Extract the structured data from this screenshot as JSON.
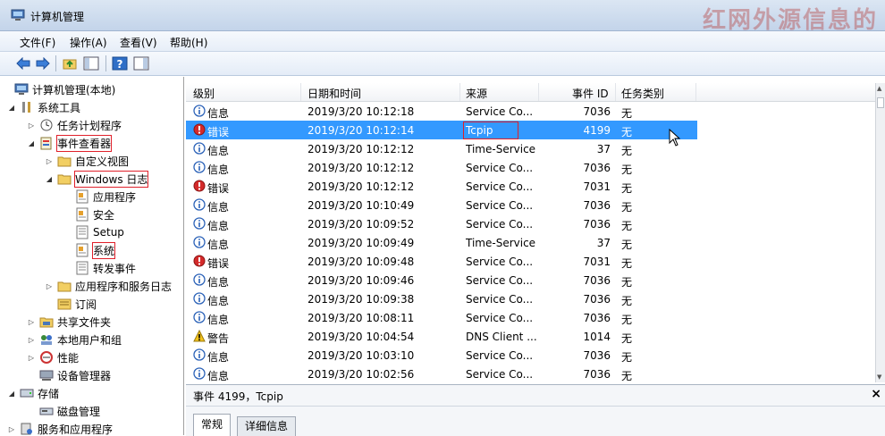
{
  "window": {
    "title": "计算机管理",
    "watermark": "红网外源信息的"
  },
  "menu": [
    "文件(F)",
    "操作(A)",
    "查看(V)",
    "帮助(H)"
  ],
  "toolbar": [
    "back-icon",
    "forward-icon",
    "folder-up-icon",
    "show-tree-icon",
    "help-icon",
    "show-pane-icon"
  ],
  "tree": [
    {
      "label": "计算机管理(本地)",
      "icon": "computer-icon",
      "arrow": "",
      "highlight": false
    },
    {
      "label": "系统工具",
      "icon": "tools-icon",
      "arrow": "◢",
      "highlight": false
    },
    {
      "label": "任务计划程序",
      "icon": "clock-icon",
      "arrow": "▷",
      "highlight": false
    },
    {
      "label": "事件查看器",
      "icon": "event-viewer-icon",
      "arrow": "◢",
      "highlight": true
    },
    {
      "label": "自定义视图",
      "icon": "folder-icon",
      "arrow": "▷",
      "highlight": false
    },
    {
      "label": "Windows 日志",
      "icon": "folder-icon",
      "arrow": "◢",
      "highlight": true
    },
    {
      "label": "应用程序",
      "icon": "log-icon",
      "arrow": "",
      "highlight": false
    },
    {
      "label": "安全",
      "icon": "log-icon",
      "arrow": "",
      "highlight": false
    },
    {
      "label": "Setup",
      "icon": "log-plain-icon",
      "arrow": "",
      "highlight": false
    },
    {
      "label": "系统",
      "icon": "log-icon",
      "arrow": "",
      "highlight": true
    },
    {
      "label": "转发事件",
      "icon": "log-plain-icon",
      "arrow": "",
      "highlight": false
    },
    {
      "label": "应用程序和服务日志",
      "icon": "folder-icon",
      "arrow": "▷",
      "highlight": false
    },
    {
      "label": "订阅",
      "icon": "subscription-icon",
      "arrow": "",
      "highlight": false
    },
    {
      "label": "共享文件夹",
      "icon": "shared-folder-icon",
      "arrow": "▷",
      "highlight": false
    },
    {
      "label": "本地用户和组",
      "icon": "users-icon",
      "arrow": "▷",
      "highlight": false
    },
    {
      "label": "性能",
      "icon": "performance-icon",
      "arrow": "▷",
      "highlight": false
    },
    {
      "label": "设备管理器",
      "icon": "device-manager-icon",
      "arrow": "",
      "highlight": false
    },
    {
      "label": "存储",
      "icon": "storage-icon",
      "arrow": "◢",
      "highlight": false
    },
    {
      "label": "磁盘管理",
      "icon": "disk-icon",
      "arrow": "",
      "highlight": false
    },
    {
      "label": "服务和应用程序",
      "icon": "services-icon",
      "arrow": "▷",
      "highlight": false
    }
  ],
  "columns": {
    "level": "级别",
    "datetime": "日期和时间",
    "source": "来源",
    "event_id": "事件 ID",
    "task": "任务类别"
  },
  "events": [
    {
      "type": "info",
      "level": "信息",
      "datetime": "2019/3/20 10:12:18",
      "source": "Service Co...",
      "event_id": "7036",
      "task": "无"
    },
    {
      "type": "error",
      "level": "错误",
      "datetime": "2019/3/20 10:12:14",
      "source": "Tcpip",
      "event_id": "4199",
      "task": "无",
      "selected": true
    },
    {
      "type": "info",
      "level": "信息",
      "datetime": "2019/3/20 10:12:12",
      "source": "Time-Service",
      "event_id": "37",
      "task": "无"
    },
    {
      "type": "info",
      "level": "信息",
      "datetime": "2019/3/20 10:12:12",
      "source": "Service Co...",
      "event_id": "7036",
      "task": "无"
    },
    {
      "type": "error",
      "level": "错误",
      "datetime": "2019/3/20 10:12:12",
      "source": "Service Co...",
      "event_id": "7031",
      "task": "无"
    },
    {
      "type": "info",
      "level": "信息",
      "datetime": "2019/3/20 10:10:49",
      "source": "Service Co...",
      "event_id": "7036",
      "task": "无"
    },
    {
      "type": "info",
      "level": "信息",
      "datetime": "2019/3/20 10:09:52",
      "source": "Service Co...",
      "event_id": "7036",
      "task": "无"
    },
    {
      "type": "info",
      "level": "信息",
      "datetime": "2019/3/20 10:09:49",
      "source": "Time-Service",
      "event_id": "37",
      "task": "无"
    },
    {
      "type": "error",
      "level": "错误",
      "datetime": "2019/3/20 10:09:48",
      "source": "Service Co...",
      "event_id": "7031",
      "task": "无"
    },
    {
      "type": "info",
      "level": "信息",
      "datetime": "2019/3/20 10:09:46",
      "source": "Service Co...",
      "event_id": "7036",
      "task": "无"
    },
    {
      "type": "info",
      "level": "信息",
      "datetime": "2019/3/20 10:09:38",
      "source": "Service Co...",
      "event_id": "7036",
      "task": "无"
    },
    {
      "type": "info",
      "level": "信息",
      "datetime": "2019/3/20 10:08:11",
      "source": "Service Co...",
      "event_id": "7036",
      "task": "无"
    },
    {
      "type": "warning",
      "level": "警告",
      "datetime": "2019/3/20 10:04:54",
      "source": "DNS Client ...",
      "event_id": "1014",
      "task": "无"
    },
    {
      "type": "info",
      "level": "信息",
      "datetime": "2019/3/20 10:03:10",
      "source": "Service Co...",
      "event_id": "7036",
      "task": "无"
    },
    {
      "type": "info",
      "level": "信息",
      "datetime": "2019/3/20 10:02:56",
      "source": "Service Co...",
      "event_id": "7036",
      "task": "无"
    }
  ],
  "detail": {
    "title": "事件 4199，Tcpip",
    "close": "×",
    "tabs": [
      "常规",
      "详细信息"
    ]
  },
  "colors": {
    "selection": "#3399ff",
    "highlight_box": "#e0202a",
    "info": "#2b62b8",
    "error": "#d42a2a",
    "warning": "#f2c21a"
  }
}
